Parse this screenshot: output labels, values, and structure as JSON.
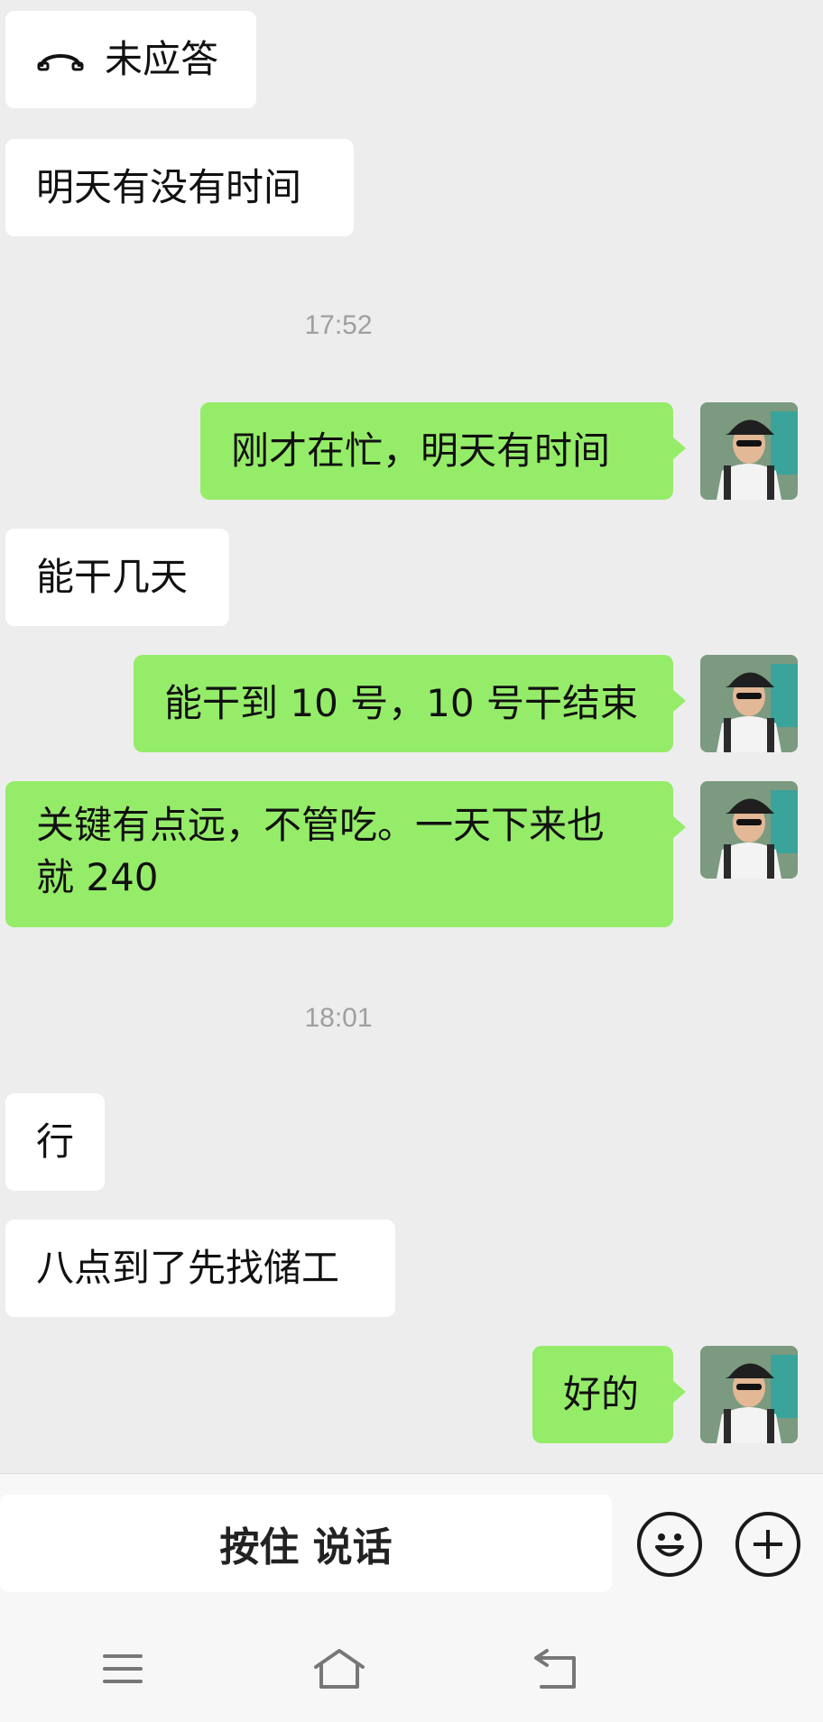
{
  "messages": {
    "missed_call": "未应答",
    "m1": "明天有没有时间",
    "time1": "17:52",
    "m2": "刚才在忙，明天有时间",
    "m3": "能干几天",
    "m4": "能干到 10 号，10 号干结束",
    "m5_line1": "关键有点远，不管吃。一天下来也",
    "m5_line2": "就 240",
    "time2": "18:01",
    "m6": "行",
    "m7": "八点到了先找储工",
    "m8": "好的"
  },
  "input_bar": {
    "hold_to_talk": "按住 说话",
    "emoji_icon": "emoji-icon",
    "plus_icon": "plus-icon"
  },
  "nav_bar": {
    "menu_icon": "menu-icon",
    "home_icon": "home-icon",
    "back_icon": "back-icon"
  },
  "colors": {
    "background": "#ededed",
    "incoming_bubble": "#ffffff",
    "outgoing_bubble": "#95ec69",
    "timestamp": "#9f9f9f"
  }
}
